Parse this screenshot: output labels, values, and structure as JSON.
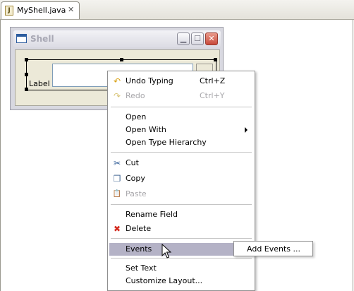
{
  "editor": {
    "tab_label": "MyShell.java",
    "tab_icon": "java-file-icon",
    "tab_icon_glyph": "J",
    "close_glyph": "✕"
  },
  "shell_preview": {
    "title": "Shell",
    "label_text": "Label",
    "buttons": {
      "minimize": "▁",
      "maximize": "☐",
      "close": "✕"
    }
  },
  "context_menu": {
    "items": [
      {
        "label": "Undo Typing",
        "accelerator": "Ctrl+Z",
        "icon": "undo-icon",
        "glyph": "↶",
        "color": "#d9a215",
        "enabled": true
      },
      {
        "label": "Redo",
        "accelerator": "Ctrl+Y",
        "icon": "redo-icon",
        "glyph": "↷",
        "color": "#d9c57a",
        "enabled": false
      },
      {
        "label": "Open",
        "enabled": true
      },
      {
        "label": "Open With",
        "enabled": true,
        "submenu": true
      },
      {
        "label": "Open Type Hierarchy",
        "enabled": true
      },
      {
        "label": "Cut",
        "icon": "scissors-icon",
        "glyph": "✂",
        "color": "#2e5b96",
        "enabled": true
      },
      {
        "label": "Copy",
        "icon": "copy-icon",
        "glyph": "❐",
        "color": "#466a96",
        "enabled": true
      },
      {
        "label": "Paste",
        "icon": "paste-icon",
        "glyph": "📋",
        "color": "#b9a97a",
        "enabled": false
      },
      {
        "label": "Rename Field",
        "enabled": true
      },
      {
        "label": "Delete",
        "icon": "delete-icon",
        "glyph": "✖",
        "color": "#d42a1e",
        "enabled": true
      },
      {
        "label": "Events",
        "enabled": true,
        "submenu": true,
        "highlighted": true
      },
      {
        "label": "Set Text",
        "enabled": true
      },
      {
        "label": "Customize Layout...",
        "enabled": true
      }
    ]
  },
  "events_submenu": {
    "items": [
      {
        "label": "Add Events ..."
      }
    ]
  },
  "colors": {
    "highlight": "#b4b2c6",
    "disabled_text": "#a7a6aa",
    "selection_handles": "#000000"
  }
}
